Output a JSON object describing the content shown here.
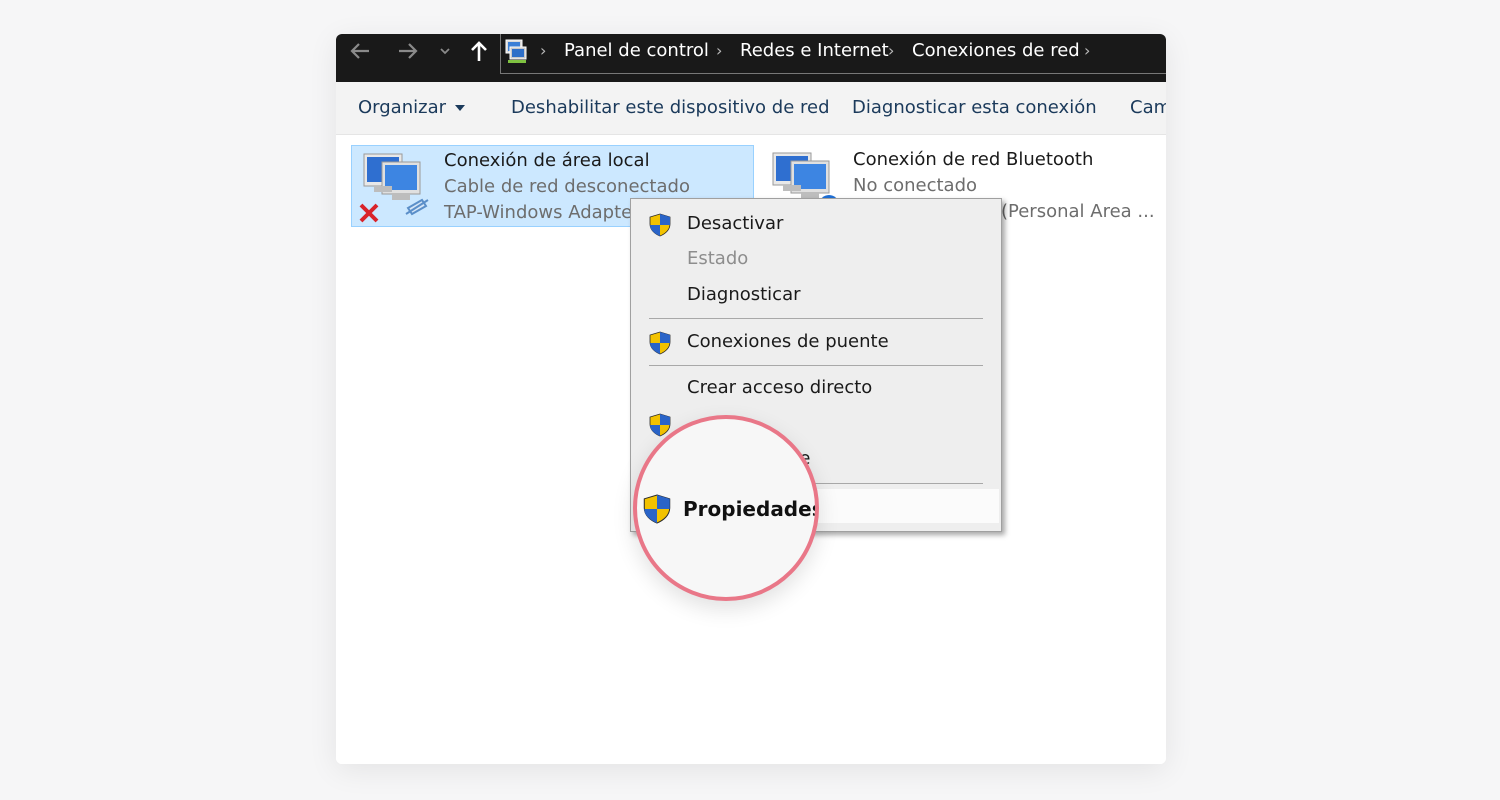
{
  "breadcrumb": {
    "items": [
      "Panel de control",
      "Redes e Internet",
      "Conexiones de red"
    ]
  },
  "toolbar": {
    "organize": "Organizar",
    "disable": "Deshabilitar este dispositivo de red",
    "diagnose": "Diagnosticar esta conexión",
    "change": "Cam"
  },
  "connections": [
    {
      "name": "Conexión de área local",
      "status": "Cable de red desconectado",
      "adapter": "TAP-Windows Adapte"
    },
    {
      "name": "Conexión de red Bluetooth",
      "status": "No conectado",
      "adapter": "(Personal Area ..."
    }
  ],
  "context_menu": {
    "items": [
      {
        "label": "Desactivar",
        "shield": true
      },
      {
        "label": "Estado",
        "shield": false,
        "disabled": true
      },
      {
        "label": "Diagnosticar",
        "shield": false
      },
      {
        "label": "Conexiones de puente",
        "shield": true
      },
      {
        "label": "Crear acceso directo",
        "shield": false
      },
      {
        "label": "",
        "shield": true
      },
      {
        "label": "bre",
        "shield": true
      },
      {
        "label": "",
        "shield": false
      }
    ]
  },
  "magnifier": {
    "label": "Propiedades"
  },
  "colors": {
    "address_bar": "#191919",
    "toolbar_text": "#1b3a5b",
    "selection": "#cce8ff",
    "magnifier_ring": "#e97788"
  },
  "icons": {
    "back": "arrow-left-icon",
    "forward": "arrow-right-icon",
    "recent": "chevron-down-icon",
    "up": "arrow-up-icon",
    "location": "network-folder-icon",
    "menu_item": "uac-shield-icon"
  }
}
